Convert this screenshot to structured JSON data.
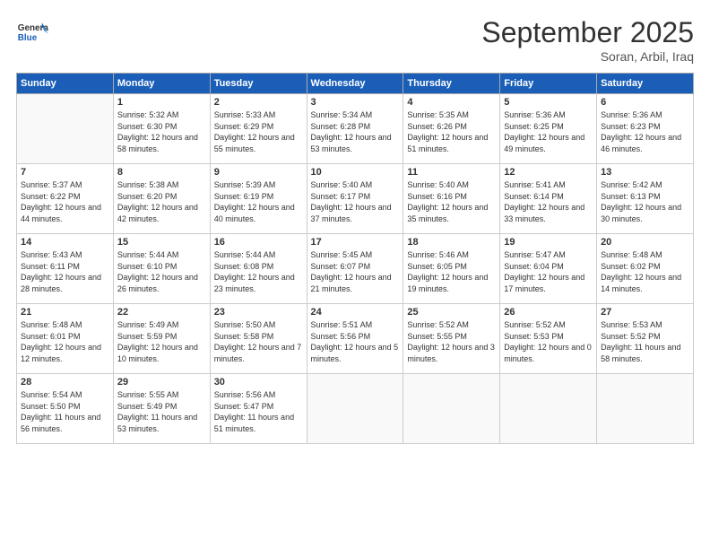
{
  "header": {
    "logo_general": "General",
    "logo_blue": "Blue",
    "month_title": "September 2025",
    "location": "Soran, Arbil, Iraq"
  },
  "weekdays": [
    "Sunday",
    "Monday",
    "Tuesday",
    "Wednesday",
    "Thursday",
    "Friday",
    "Saturday"
  ],
  "weeks": [
    [
      {
        "day": "",
        "empty": true
      },
      {
        "day": "1",
        "sunrise": "5:32 AM",
        "sunset": "6:30 PM",
        "daylight": "12 hours and 58 minutes."
      },
      {
        "day": "2",
        "sunrise": "5:33 AM",
        "sunset": "6:29 PM",
        "daylight": "12 hours and 55 minutes."
      },
      {
        "day": "3",
        "sunrise": "5:34 AM",
        "sunset": "6:28 PM",
        "daylight": "12 hours and 53 minutes."
      },
      {
        "day": "4",
        "sunrise": "5:35 AM",
        "sunset": "6:26 PM",
        "daylight": "12 hours and 51 minutes."
      },
      {
        "day": "5",
        "sunrise": "5:36 AM",
        "sunset": "6:25 PM",
        "daylight": "12 hours and 49 minutes."
      },
      {
        "day": "6",
        "sunrise": "5:36 AM",
        "sunset": "6:23 PM",
        "daylight": "12 hours and 46 minutes."
      }
    ],
    [
      {
        "day": "7",
        "sunrise": "5:37 AM",
        "sunset": "6:22 PM",
        "daylight": "12 hours and 44 minutes."
      },
      {
        "day": "8",
        "sunrise": "5:38 AM",
        "sunset": "6:20 PM",
        "daylight": "12 hours and 42 minutes."
      },
      {
        "day": "9",
        "sunrise": "5:39 AM",
        "sunset": "6:19 PM",
        "daylight": "12 hours and 40 minutes."
      },
      {
        "day": "10",
        "sunrise": "5:40 AM",
        "sunset": "6:17 PM",
        "daylight": "12 hours and 37 minutes."
      },
      {
        "day": "11",
        "sunrise": "5:40 AM",
        "sunset": "6:16 PM",
        "daylight": "12 hours and 35 minutes."
      },
      {
        "day": "12",
        "sunrise": "5:41 AM",
        "sunset": "6:14 PM",
        "daylight": "12 hours and 33 minutes."
      },
      {
        "day": "13",
        "sunrise": "5:42 AM",
        "sunset": "6:13 PM",
        "daylight": "12 hours and 30 minutes."
      }
    ],
    [
      {
        "day": "14",
        "sunrise": "5:43 AM",
        "sunset": "6:11 PM",
        "daylight": "12 hours and 28 minutes."
      },
      {
        "day": "15",
        "sunrise": "5:44 AM",
        "sunset": "6:10 PM",
        "daylight": "12 hours and 26 minutes."
      },
      {
        "day": "16",
        "sunrise": "5:44 AM",
        "sunset": "6:08 PM",
        "daylight": "12 hours and 23 minutes."
      },
      {
        "day": "17",
        "sunrise": "5:45 AM",
        "sunset": "6:07 PM",
        "daylight": "12 hours and 21 minutes."
      },
      {
        "day": "18",
        "sunrise": "5:46 AM",
        "sunset": "6:05 PM",
        "daylight": "12 hours and 19 minutes."
      },
      {
        "day": "19",
        "sunrise": "5:47 AM",
        "sunset": "6:04 PM",
        "daylight": "12 hours and 17 minutes."
      },
      {
        "day": "20",
        "sunrise": "5:48 AM",
        "sunset": "6:02 PM",
        "daylight": "12 hours and 14 minutes."
      }
    ],
    [
      {
        "day": "21",
        "sunrise": "5:48 AM",
        "sunset": "6:01 PM",
        "daylight": "12 hours and 12 minutes."
      },
      {
        "day": "22",
        "sunrise": "5:49 AM",
        "sunset": "5:59 PM",
        "daylight": "12 hours and 10 minutes."
      },
      {
        "day": "23",
        "sunrise": "5:50 AM",
        "sunset": "5:58 PM",
        "daylight": "12 hours and 7 minutes."
      },
      {
        "day": "24",
        "sunrise": "5:51 AM",
        "sunset": "5:56 PM",
        "daylight": "12 hours and 5 minutes."
      },
      {
        "day": "25",
        "sunrise": "5:52 AM",
        "sunset": "5:55 PM",
        "daylight": "12 hours and 3 minutes."
      },
      {
        "day": "26",
        "sunrise": "5:52 AM",
        "sunset": "5:53 PM",
        "daylight": "12 hours and 0 minutes."
      },
      {
        "day": "27",
        "sunrise": "5:53 AM",
        "sunset": "5:52 PM",
        "daylight": "11 hours and 58 minutes."
      }
    ],
    [
      {
        "day": "28",
        "sunrise": "5:54 AM",
        "sunset": "5:50 PM",
        "daylight": "11 hours and 56 minutes."
      },
      {
        "day": "29",
        "sunrise": "5:55 AM",
        "sunset": "5:49 PM",
        "daylight": "11 hours and 53 minutes."
      },
      {
        "day": "30",
        "sunrise": "5:56 AM",
        "sunset": "5:47 PM",
        "daylight": "11 hours and 51 minutes."
      },
      {
        "day": "",
        "empty": true
      },
      {
        "day": "",
        "empty": true
      },
      {
        "day": "",
        "empty": true
      },
      {
        "day": "",
        "empty": true
      }
    ]
  ]
}
